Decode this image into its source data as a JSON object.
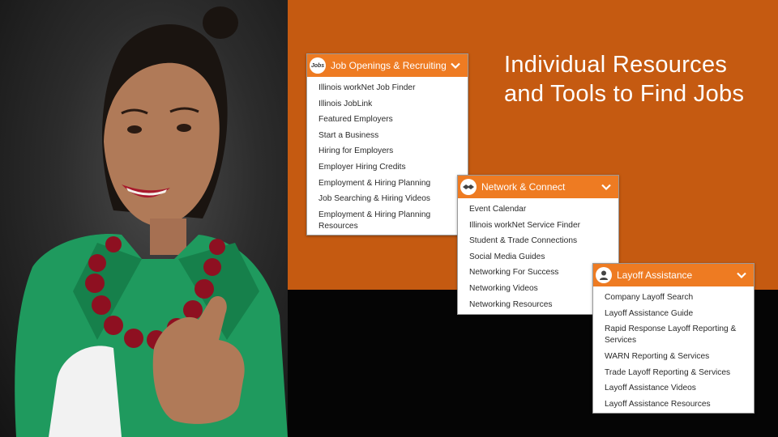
{
  "slide": {
    "title": "Individual Resources and Tools to Find Jobs"
  },
  "colors": {
    "orange_panel": "#c55a11",
    "menu_header": "#ee7b22",
    "dark_panel": "#050505"
  },
  "menus": {
    "jobs": {
      "logo_text": "Jobs",
      "header": "Job Openings & Recruiting",
      "items": [
        "Illinois workNet Job Finder",
        "Illinois JobLink",
        "Featured Employers",
        "Start a Business",
        "Hiring for Employers",
        "Employer Hiring Credits",
        "Employment & Hiring Planning",
        "Job Searching & Hiring Videos",
        "Employment & Hiring Planning Resources"
      ]
    },
    "network": {
      "logo_icon": "handshake-icon",
      "header": "Network & Connect",
      "items": [
        "Event Calendar",
        "Illinois workNet Service Finder",
        "Student & Trade Connections",
        "Social Media Guides",
        "Networking For Success",
        "Networking Videos",
        "Networking Resources"
      ]
    },
    "layoff": {
      "logo_icon": "person-icon",
      "header": "Layoff Assistance",
      "items": [
        "Company Layoff Search",
        "Layoff Assistance Guide",
        "Rapid Response Layoff Reporting & Services",
        "WARN Reporting & Services",
        "Trade Layoff Reporting & Services",
        "Layoff Assistance Videos",
        "Layoff Assistance Resources"
      ]
    }
  }
}
